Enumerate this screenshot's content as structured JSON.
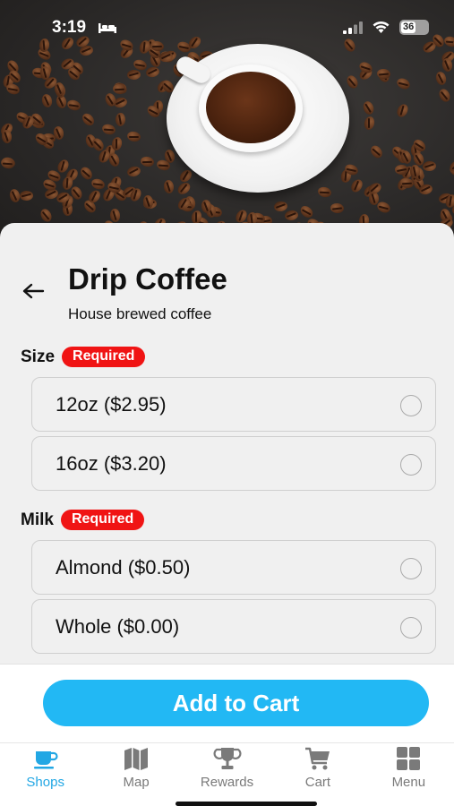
{
  "status_bar": {
    "time": "3:19",
    "battery": "36"
  },
  "product": {
    "title": "Drip Coffee",
    "subtitle": "House brewed coffee"
  },
  "groups": [
    {
      "label": "Size",
      "badge": "Required",
      "options": [
        "12oz ($2.95)",
        "16oz ($3.20)"
      ]
    },
    {
      "label": "Milk",
      "badge": "Required",
      "options": [
        "Almond ($0.50)",
        "Whole ($0.00)"
      ]
    }
  ],
  "cta": {
    "label": "Add to Cart"
  },
  "tabs": [
    {
      "label": "Shops",
      "icon": "coffee-cup-icon",
      "active": true
    },
    {
      "label": "Map",
      "icon": "map-icon",
      "active": false
    },
    {
      "label": "Rewards",
      "icon": "trophy-icon",
      "active": false
    },
    {
      "label": "Cart",
      "icon": "cart-icon",
      "active": false
    },
    {
      "label": "Menu",
      "icon": "grid-icon",
      "active": false
    }
  ],
  "colors": {
    "accent": "#22b8f4",
    "required": "#f01414",
    "active_tab": "#22a7e4"
  }
}
